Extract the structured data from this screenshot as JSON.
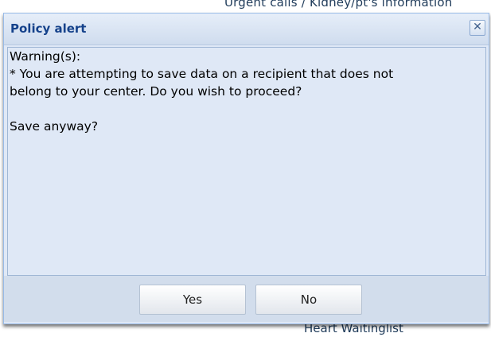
{
  "background": {
    "top_text": "Urgent calls / Kidney/pt's information",
    "bottom_text": "Heart Waitinglist"
  },
  "dialog": {
    "title": "Policy alert",
    "close_icon": "close-icon",
    "close_glyph": "✕",
    "message": {
      "heading": "Warning(s):",
      "line1": "* You are attempting to save data on a recipient that does not",
      "line2": "belong to your center. Do you wish to proceed?",
      "question": "Save anyway?"
    },
    "buttons": {
      "yes": "Yes",
      "no": "No"
    }
  },
  "colors": {
    "title_text": "#15428b",
    "dialog_bg": "#dfe8f6",
    "footer_bg": "#d2ddec"
  }
}
